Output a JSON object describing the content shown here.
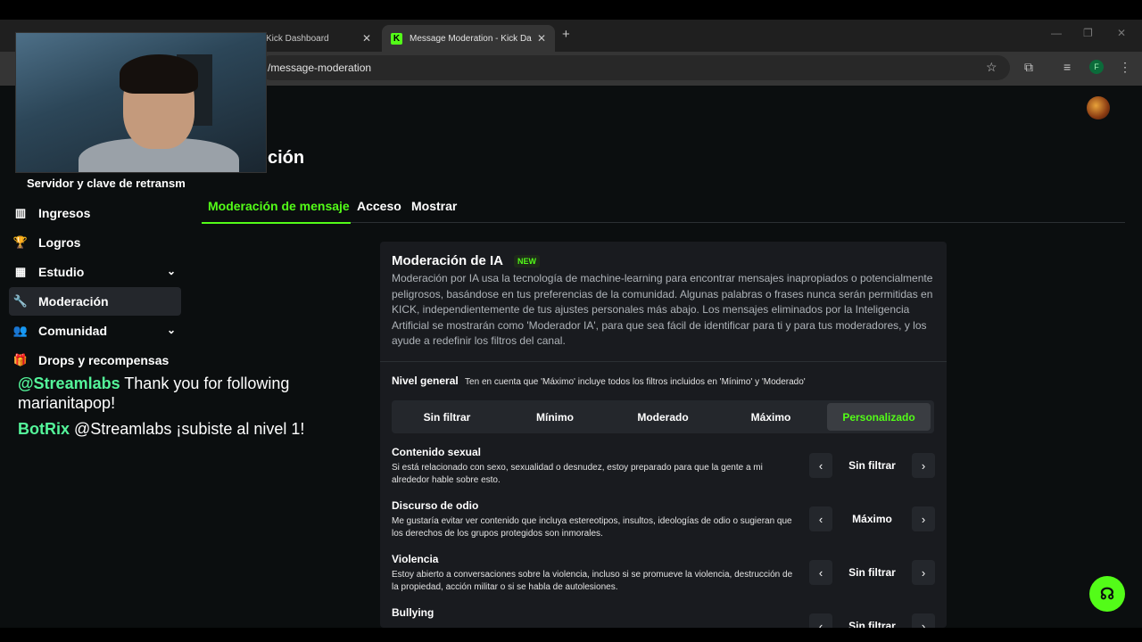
{
  "browser": {
    "tabs": [
      {
        "label": "Kick Dashboard",
        "close": "✕"
      },
      {
        "label": "Message Moderation - Kick Das",
        "close": "✕",
        "favicon": "K"
      }
    ],
    "new_tab": "+",
    "url": "/message-moderation",
    "profile_initial": "F",
    "window_controls": [
      "—",
      "❐",
      "✕"
    ]
  },
  "page": {
    "heading_tail": "ción",
    "server_key": "Servidor y clave de retransm"
  },
  "sidebar": {
    "items": [
      {
        "label": "Ingresos",
        "icon": "chart-icon",
        "glyph": "▥"
      },
      {
        "label": "Logros",
        "icon": "trophy-icon",
        "glyph": "🏆"
      },
      {
        "label": "Estudio",
        "icon": "studio-icon",
        "glyph": "▦",
        "chevron": "⌄"
      },
      {
        "label": "Moderación",
        "icon": "wrench-icon",
        "glyph": "🔧"
      },
      {
        "label": "Comunidad",
        "icon": "community-icon",
        "glyph": "👥",
        "chevron": "⌄"
      },
      {
        "label": "Drops y recompensas",
        "icon": "gift-icon",
        "glyph": "🎁"
      }
    ]
  },
  "chat": [
    {
      "user": "@Streamlabs",
      "message": "Thank you for following",
      "message_cont": "marianitapop!"
    },
    {
      "user": "BotRix",
      "message": "@Streamlabs ¡subiste al nivel 1!"
    }
  ],
  "tabs": [
    {
      "label": "Moderación de mensaje"
    },
    {
      "label": "Acceso"
    },
    {
      "label": "Mostrar"
    }
  ],
  "card": {
    "title": "Moderación de IA",
    "badge": "NEW",
    "description": "Moderación por IA usa la tecnología de machine-learning para encontrar mensajes inapropiados o potencialmente peligrosos, basándose en tus preferencias de la comunidad. Algunas palabras o frases nunca serán permitidas en KICK, independientemente de tus ajustes personales más abajo. Los mensajes eliminados por la Inteligencia Artificial se mostrarán como 'Moderador IA', para que sea fácil de identificar para ti y para tus moderadores, y los ayude a redefinir los filtros del canal.",
    "nivel_label": "Nivel general",
    "nivel_note": "Ten en cuenta que 'Máximo' incluye todos los filtros incluidos en 'Mínimo' y 'Moderado'",
    "levels": [
      "Sin filtrar",
      "Mínimo",
      "Moderado",
      "Máximo",
      "Personalizado"
    ],
    "selected_level": "Personalizado",
    "categories": [
      {
        "title": "Contenido sexual",
        "description": "Si está relacionado con sexo, sexualidad o desnudez, estoy preparado para que la gente a mi alrededor hable sobre esto.",
        "value": "Sin filtrar"
      },
      {
        "title": "Discurso de odio",
        "description": "Me gustaría evitar ver contenido que incluya estereotipos, insultos, ideologías de odio o sugieran que los derechos de los grupos protegidos son inmorales.",
        "value": "Máximo"
      },
      {
        "title": "Violencia",
        "description": "Estoy abierto a conversaciones sobre la violencia, incluso si se promueve la violencia, destrucción de la propiedad, acción militar o si se habla de autolesiones.",
        "value": "Sin filtrar"
      },
      {
        "title": "Bullying",
        "description": "",
        "value": "Sin filtrar"
      }
    ],
    "arrow_prev": "‹",
    "arrow_next": "›"
  },
  "colors": {
    "accent": "#53fc18",
    "chat_user": "#54f59a",
    "background": "#0b0e0f",
    "card": "#191b1f"
  }
}
